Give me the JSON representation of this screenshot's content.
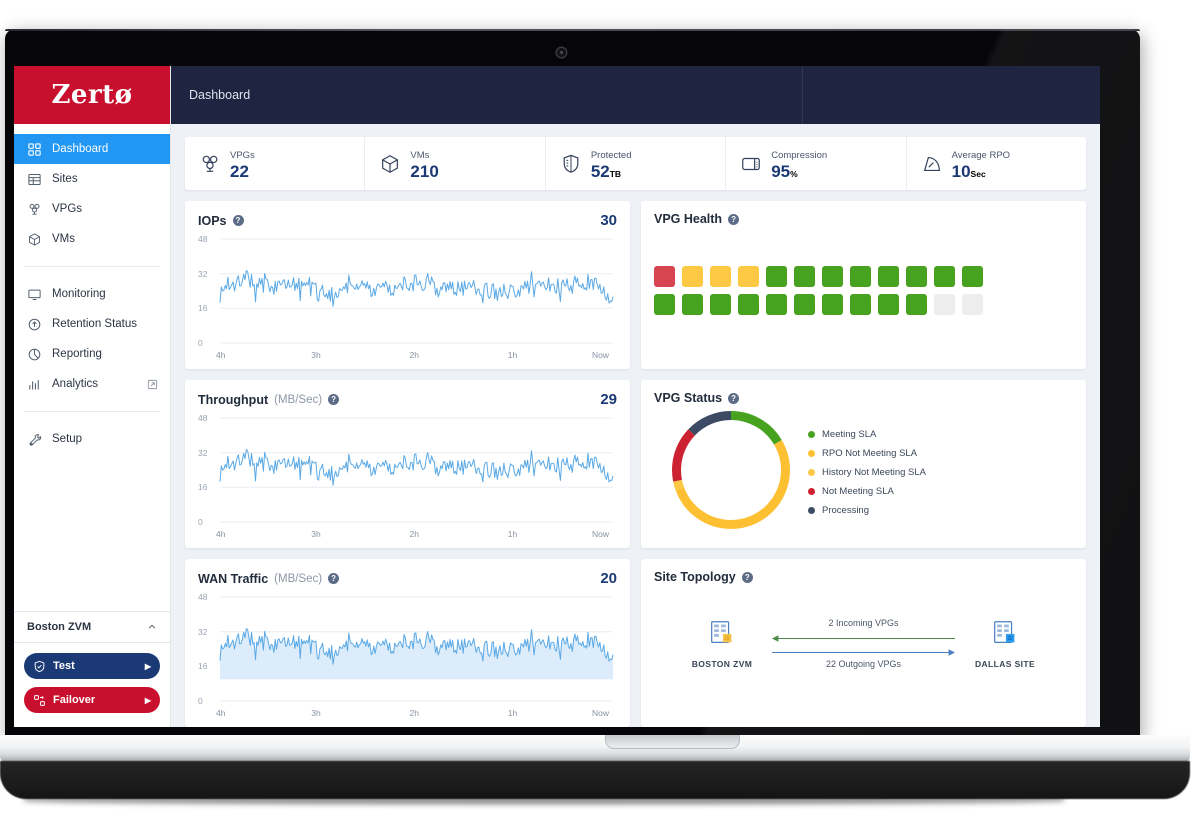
{
  "brand": {
    "name": "Zertø"
  },
  "topbar": {
    "title": "Dashboard"
  },
  "sidebar": {
    "items": [
      {
        "label": "Dashboard",
        "icon": "dashboard-icon",
        "active": true
      },
      {
        "label": "Sites",
        "icon": "sites-icon",
        "active": false
      },
      {
        "label": "VPGs",
        "icon": "vpgs-icon",
        "active": false
      },
      {
        "label": "VMs",
        "icon": "vms-icon",
        "active": false
      },
      {
        "label": "Monitoring",
        "icon": "monitor-icon",
        "active": false
      },
      {
        "label": "Retention Status",
        "icon": "retention-icon",
        "active": false
      },
      {
        "label": "Reporting",
        "icon": "pie-icon",
        "active": false
      },
      {
        "label": "Analytics",
        "icon": "bar-chart-icon",
        "active": false,
        "external": true
      },
      {
        "label": "Setup",
        "icon": "wrench-icon",
        "active": false
      }
    ],
    "zvm": {
      "title": "Boston ZVM",
      "collapse_icon": "chevron-up-icon",
      "actions": [
        {
          "label": "Test",
          "icon": "shield-check-icon",
          "arrow": "▶",
          "color": "#1b3a75"
        },
        {
          "label": "Failover",
          "icon": "failover-icon",
          "arrow": "▶",
          "color": "#c8102e"
        }
      ]
    }
  },
  "stats": [
    {
      "label": "VPGs",
      "value": "22",
      "unit": "",
      "icon": "vpgs-icon"
    },
    {
      "label": "VMs",
      "value": "210",
      "unit": "",
      "icon": "vms-icon"
    },
    {
      "label": "Protected",
      "value": "52",
      "unit": "TB",
      "icon": "shield-icon"
    },
    {
      "label": "Compression",
      "value": "95",
      "unit": "%",
      "icon": "compression-icon"
    },
    {
      "label": "Average RPO",
      "value": "10",
      "unit": "Sec",
      "icon": "gauge-icon"
    }
  ],
  "cards": {
    "iops": {
      "title": "IOPs",
      "subtitle": "",
      "value": "30",
      "help": "?"
    },
    "vpg_health": {
      "title": "VPG Health",
      "help": "?"
    },
    "throughput": {
      "title": "Throughput",
      "subtitle": "(MB/Sec)",
      "value": "29",
      "help": "?"
    },
    "vpg_status": {
      "title": "VPG Status",
      "help": "?"
    },
    "wan": {
      "title": "WAN Traffic",
      "subtitle": "(MB/Sec)",
      "value": "20",
      "help": "?"
    },
    "topology": {
      "title": "Site Topology",
      "help": "?"
    }
  },
  "topology": {
    "left_node": {
      "label": "BOSTON ZVM",
      "icon": "server-building-icon"
    },
    "right_node": {
      "label": "DALLAS SITE",
      "icon": "server-building-icon"
    },
    "incoming_label": "2 Incoming VPGs",
    "outgoing_label": "22 Outgoing VPGs",
    "incoming_color": "#4f8a4a",
    "outgoing_color": "#4a7fc1"
  },
  "colors": {
    "brand_red": "#c8102e",
    "navy": "#1f2440",
    "accent_blue": "#2196f3",
    "value_blue": "#1b3a75",
    "green": "#47a31f",
    "yellow": "#fdc944",
    "orange": "#fbbd2e",
    "red": "#d64550",
    "slate": "#3c4b63",
    "gray": "#ededed",
    "line_blue": "#5aa9e6"
  },
  "chart_data": [
    {
      "type": "line",
      "name": "iops",
      "title": "IOPs",
      "value_badge": 30,
      "ylabel": "",
      "xlabel": "",
      "ylim": [
        0,
        48
      ],
      "yticks": [
        0,
        16,
        32,
        48
      ],
      "xticks": [
        "4h",
        "3h",
        "2h",
        "1h",
        "Now"
      ],
      "grid": true,
      "series": [
        {
          "name": "IOPs",
          "color": "#5aa9e6",
          "values": [
            24,
            26,
            22,
            28,
            23,
            31,
            25,
            22,
            27,
            24,
            30,
            26,
            23,
            29,
            25,
            22,
            28,
            24,
            31,
            26,
            23,
            27,
            25,
            30,
            22,
            28,
            24,
            26,
            31,
            23,
            27,
            25,
            29,
            22,
            26,
            24,
            30,
            28,
            23,
            27,
            25,
            31,
            24,
            22,
            29,
            26,
            28,
            23,
            30,
            25,
            27,
            24,
            32,
            26,
            22,
            29,
            25,
            28,
            23,
            31,
            26,
            24,
            27,
            30,
            25,
            22,
            28,
            26,
            31,
            23,
            27,
            25,
            29,
            24,
            26,
            22,
            30,
            28,
            25,
            31,
            23,
            27,
            24,
            29,
            26,
            22,
            28,
            30,
            25,
            23,
            27,
            31,
            24,
            26,
            29,
            22,
            28,
            25,
            30,
            27,
            23,
            26,
            24,
            31,
            28,
            22,
            29,
            25,
            27,
            30,
            24,
            26,
            23,
            28,
            31,
            25,
            27,
            22,
            29,
            26,
            30,
            24,
            28,
            23,
            25,
            31,
            27,
            26,
            22,
            29,
            24,
            30,
            28,
            25,
            23,
            27,
            26,
            31,
            22,
            29,
            25,
            28,
            24,
            30,
            27,
            23,
            26,
            29,
            31,
            24,
            22,
            28,
            25,
            27,
            30,
            26,
            23,
            29,
            24,
            31,
            28,
            22,
            26,
            25,
            30,
            27,
            24,
            29,
            23,
            28,
            26,
            31,
            25,
            22,
            30,
            27,
            24,
            28,
            26,
            29,
            23,
            31,
            25,
            27,
            22,
            30,
            26,
            28,
            24,
            29,
            25,
            31,
            23,
            27,
            26,
            30,
            22,
            28,
            24,
            29,
            27,
            25,
            31,
            26,
            23,
            30,
            28,
            24,
            22,
            27,
            29,
            25,
            33,
            31,
            26,
            24,
            29,
            27,
            23,
            30,
            25,
            28,
            22,
            26,
            31,
            29,
            24,
            27,
            30,
            25,
            23,
            28,
            26,
            22,
            29,
            31,
            27,
            24,
            25,
            30,
            28,
            26,
            23,
            29,
            27,
            31,
            24,
            22,
            26,
            30,
            25,
            28,
            23,
            27,
            29,
            31,
            26,
            24,
            22,
            28,
            30,
            25,
            27,
            23,
            29,
            26,
            31,
            24,
            28,
            22,
            25,
            30,
            27,
            26,
            29,
            23,
            31,
            25,
            28,
            24,
            22,
            27,
            30,
            26,
            29,
            23,
            25,
            31,
            28,
            24,
            27,
            22,
            26,
            30,
            25,
            29,
            23,
            28,
            31,
            24,
            26,
            27,
            22,
            30,
            25,
            29,
            26,
            23,
            28,
            24,
            31,
            27,
            25,
            22,
            29,
            30,
            26,
            24,
            28,
            23,
            27,
            31,
            25,
            26,
            22,
            29,
            24,
            30,
            28,
            27,
            23,
            25,
            31,
            26,
            29,
            24,
            22,
            28,
            30,
            27,
            25,
            23,
            26,
            31,
            29,
            24,
            28,
            22,
            27,
            30,
            25,
            26,
            23,
            29,
            31,
            28,
            24,
            27,
            22,
            30,
            25,
            29,
            26,
            28,
            23,
            24,
            27,
            31,
            25,
            22,
            30,
            26,
            29,
            24,
            28,
            23,
            27,
            25,
            31,
            26,
            22,
            30,
            28,
            24,
            29,
            25,
            27,
            23,
            26,
            31,
            28,
            22,
            24,
            30,
            27,
            25,
            29,
            23,
            26,
            28,
            31,
            24,
            22,
            27,
            30,
            25,
            26,
            29,
            23,
            28,
            24,
            31,
            27,
            22,
            25,
            30,
            26,
            29,
            24,
            28,
            23,
            27,
            31,
            25,
            22,
            26,
            30,
            28,
            24,
            29,
            23,
            27,
            25,
            31,
            26,
            22,
            28,
            30,
            24,
            27,
            25,
            29,
            23,
            31,
            26,
            28,
            22,
            24,
            30,
            27,
            25,
            26,
            29,
            23,
            28,
            31,
            24,
            22,
            27,
            26,
            30,
            25,
            29,
            23,
            24,
            28,
            31,
            27,
            22,
            26,
            25,
            30,
            24,
            29,
            23,
            27,
            31,
            26,
            28,
            22,
            25,
            24,
            30,
            27,
            23,
            29,
            26,
            31,
            25,
            28,
            22,
            24,
            27,
            30,
            26,
            23,
            29,
            25,
            31,
            28,
            26,
            22,
            24,
            27,
            30,
            25,
            29,
            23,
            26,
            31,
            28,
            24,
            22,
            27,
            25,
            30,
            29,
            23,
            26,
            28,
            31,
            24,
            22,
            27,
            30,
            25,
            29,
            26,
            23,
            28,
            24,
            31,
            27,
            22,
            26,
            30,
            25,
            28,
            24,
            29,
            23,
            27,
            31,
            26,
            22,
            25,
            30,
            28,
            24,
            26,
            29,
            23,
            31,
            27,
            25,
            22,
            28,
            30,
            26,
            24,
            27,
            29,
            23,
            25,
            31,
            28,
            22,
            26,
            30,
            24,
            27,
            25,
            29,
            23,
            28,
            31,
            26,
            22,
            24,
            30,
            25,
            27,
            29,
            23,
            26,
            31,
            28,
            24,
            22,
            27,
            30,
            26,
            25,
            29,
            23,
            31,
            28,
            24,
            26,
            22,
            30,
            27,
            25,
            24,
            29,
            23,
            26,
            28,
            22,
            25,
            23,
            21,
            19
          ]
        }
      ]
    },
    {
      "type": "line",
      "name": "throughput",
      "title": "Throughput (MB/Sec)",
      "value_badge": 29,
      "ylim": [
        0,
        48
      ],
      "yticks": [
        0,
        16,
        32,
        48
      ],
      "xticks": [
        "4h",
        "3h",
        "2h",
        "1h",
        "Now"
      ],
      "grid": true,
      "series": [
        {
          "name": "Throughput",
          "color": "#5aa9e6",
          "values": []
        }
      ]
    },
    {
      "type": "area",
      "name": "wan_traffic",
      "title": "WAN Traffic (MB/Sec)",
      "value_badge": 20,
      "ylim": [
        0,
        48
      ],
      "yticks": [
        0,
        16,
        32,
        48
      ],
      "xticks": [
        "4h",
        "3h",
        "2h",
        "1h",
        "Now"
      ],
      "grid": true,
      "fill_color": "#d6e9fa",
      "series": [
        {
          "name": "WAN Traffic",
          "color": "#5aa9e6",
          "values": []
        }
      ]
    },
    {
      "type": "bar",
      "name": "vpg_health",
      "title": "VPG Health",
      "categories": [
        "red",
        "yellow",
        "yellow",
        "yellow",
        "green",
        "green",
        "green",
        "green",
        "green",
        "green",
        "green",
        "green",
        "green",
        "green",
        "green",
        "green",
        "green",
        "green",
        "green",
        "green",
        "green",
        "green",
        "empty",
        "empty"
      ],
      "values": [
        1,
        1,
        1,
        1,
        1,
        1,
        1,
        1,
        1,
        1,
        1,
        1,
        1,
        1,
        1,
        1,
        1,
        1,
        1,
        1,
        1,
        1,
        0,
        0
      ],
      "legend_colors": {
        "red": "#d64550",
        "yellow": "#fdc944",
        "green": "#47a31f",
        "empty": "#ededed"
      }
    },
    {
      "type": "pie",
      "name": "vpg_status",
      "title": "VPG Status",
      "labels": [
        "Meeting SLA",
        "RPO Not Meeting SLA",
        "History Not Meeting SLA",
        "Not Meeting SLA",
        "Processing"
      ],
      "values": [
        14,
        45,
        2,
        13,
        11
      ],
      "colors": [
        "#47a31f",
        "#fdc033",
        "#fdc944",
        "#cc2131",
        "#3c4b63"
      ],
      "legend_position": "right",
      "donut": true
    }
  ]
}
